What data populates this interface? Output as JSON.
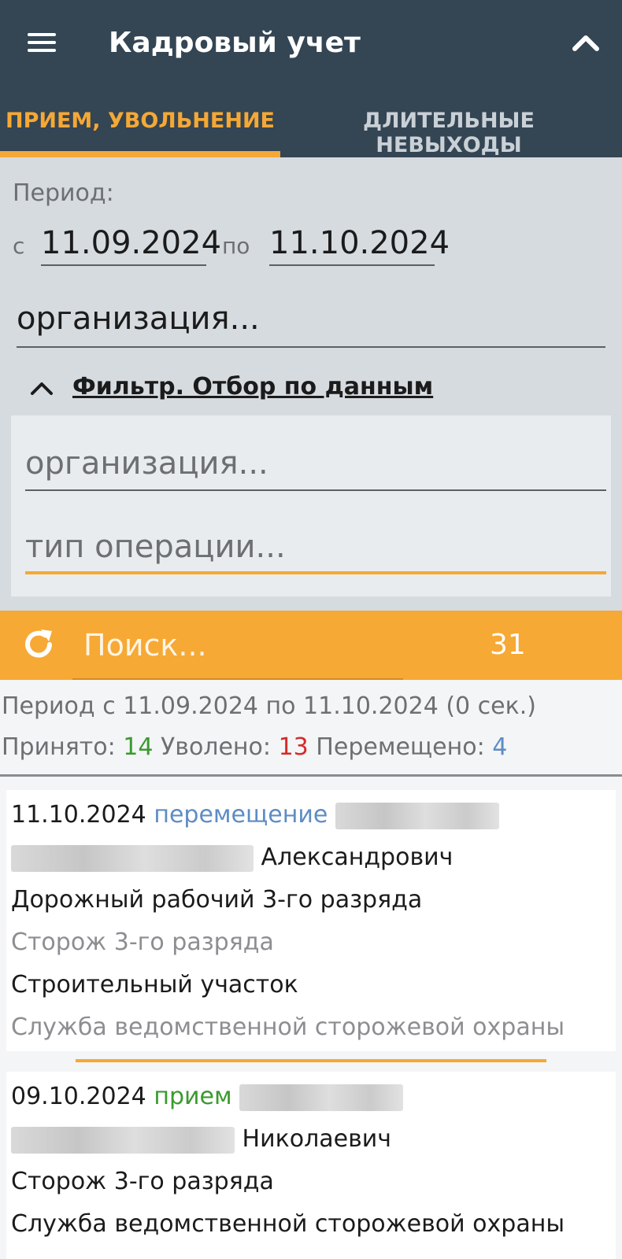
{
  "app": {
    "title": "Кадровый учет"
  },
  "tabs": [
    {
      "label": "ПРИЕМ, УВОЛЬНЕНИЕ",
      "active": true
    },
    {
      "label": "ДЛИТЕЛЬНЫЕ НЕВЫХОДЫ",
      "active": false
    }
  ],
  "filters": {
    "period_label": "Период:",
    "from_label": "с",
    "from_date": "11.09.2024",
    "to_label": "по",
    "to_date": "11.10.2024",
    "organization_placeholder": "организация...",
    "filter_toggle_label": "Фильтр. Отбор по данным",
    "panel": {
      "organization_placeholder": "организация...",
      "operation_type_placeholder": "тип операции..."
    }
  },
  "search": {
    "placeholder": "Поиск...",
    "count": "31"
  },
  "summary": {
    "period_text": "Период с 11.09.2024 по 11.10.2024 (0 сек.)",
    "hired_label": "Принято:",
    "hired_count": "14",
    "fired_label": "Уволено:",
    "fired_count": "13",
    "moved_label": "Перемещено:",
    "moved_count": "4"
  },
  "records": [
    {
      "date": "11.10.2024",
      "operation": "перемещение",
      "patronymic": "Александрович",
      "position": "Дорожный рабочий 3-го разряда",
      "prev_position": "Сторож 3-го разряда",
      "department": "Строительный участок",
      "prev_department": "Служба ведомственной сторожевой охраны"
    },
    {
      "date": "09.10.2024",
      "operation": "прием",
      "patronymic": "Николаевич",
      "position": "Сторож 3-го разряда",
      "department": "Служба ведомственной сторожевой охраны"
    }
  ],
  "colors": {
    "appbar": "#344554",
    "accent": "#f5a835",
    "hired": "#3a9a2f",
    "fired": "#d62a2a",
    "moved": "#5e8cc5"
  },
  "icons": {
    "menu": "menu-icon",
    "collapse": "chevron-up-icon",
    "filter_toggle": "chevron-up-icon",
    "refresh": "refresh-icon"
  }
}
